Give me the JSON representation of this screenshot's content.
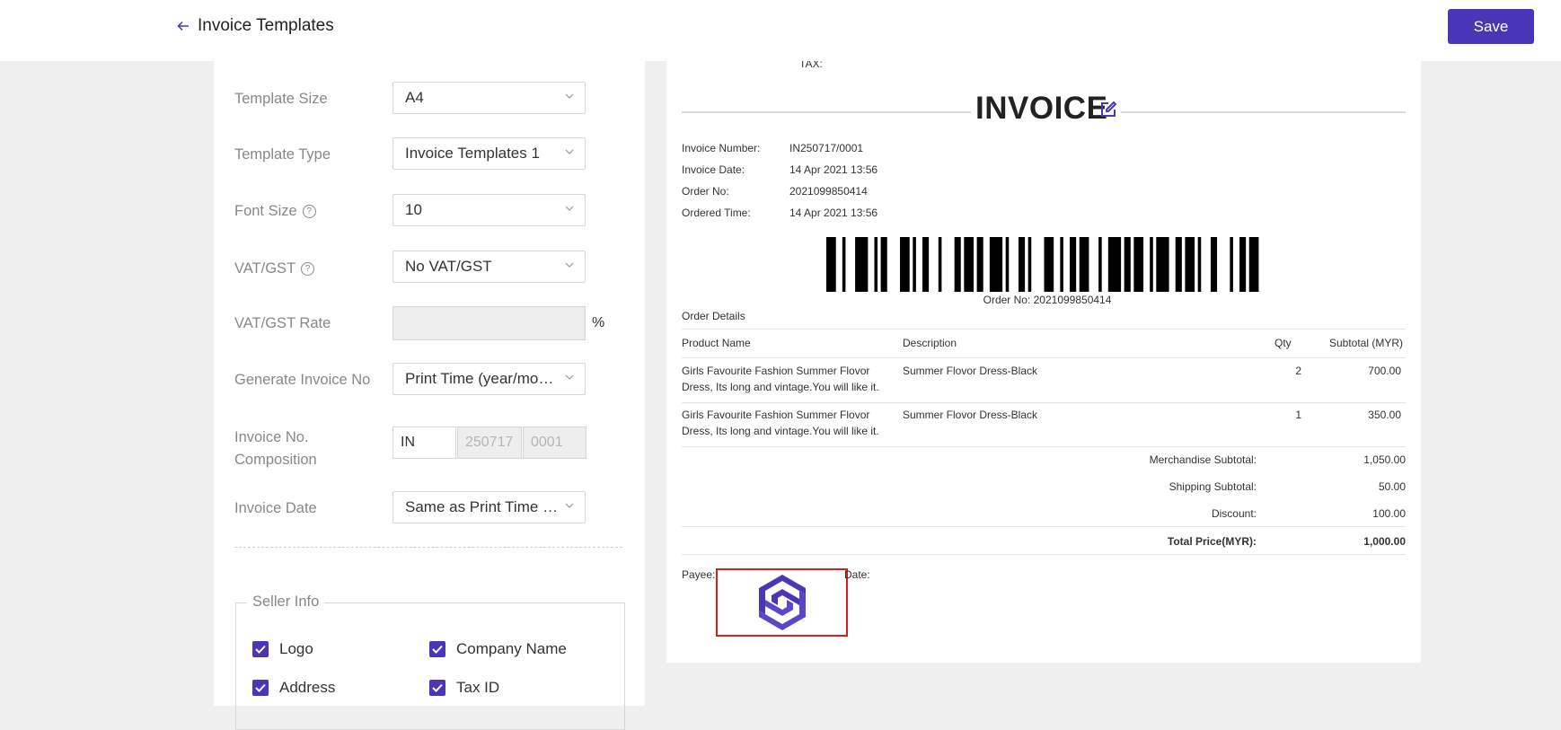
{
  "header": {
    "title": "Invoice Templates",
    "save_label": "Save"
  },
  "settings": {
    "template_size": {
      "label": "Template Size",
      "value": "A4"
    },
    "template_type": {
      "label": "Template Type",
      "value": "Invoice Templates 1"
    },
    "font_size": {
      "label": "Font Size",
      "value": "10"
    },
    "vat_gst": {
      "label": "VAT/GST",
      "value": "No VAT/GST"
    },
    "vat_gst_rate": {
      "label": "VAT/GST Rate",
      "value": "",
      "unit": "%"
    },
    "generate_invoice_no": {
      "label": "Generate Invoice No",
      "value": "Print Time (year/month/day)"
    },
    "invoice_no_composition": {
      "label_line1": "Invoice No.",
      "label_line2": "Composition",
      "prefix": "IN",
      "date_part": "250717",
      "serial_part": "0001"
    },
    "invoice_date": {
      "label": "Invoice Date",
      "value": "Same as Print Time / Order Time"
    }
  },
  "seller_info": {
    "legend": "Seller Info",
    "checkboxes": [
      {
        "label": "Logo",
        "checked": true
      },
      {
        "label": "Company Name",
        "checked": true
      },
      {
        "label": "Address",
        "checked": true
      },
      {
        "label": "Tax ID",
        "checked": true
      }
    ]
  },
  "invoice": {
    "cut_text": "TAX:",
    "title": "INVOICE",
    "meta": [
      {
        "key": "Invoice Number:",
        "value": "IN250717/0001"
      },
      {
        "key": "Invoice Date:",
        "value": "14 Apr 2021 13:56"
      },
      {
        "key": "Order No:",
        "value": "2021099850414"
      },
      {
        "key": "Ordered Time:",
        "value": "14 Apr 2021 13:56"
      }
    ],
    "barcode_text": "Order No: 2021099850414",
    "order_details_title": "Order Details",
    "columns": {
      "product": "Product Name",
      "description": "Description",
      "qty": "Qty",
      "subtotal": "Subtotal (MYR)"
    },
    "items": [
      {
        "product": "Girls Favourite Fashion Summer Flovor Dress, Its long and vintage.You will like it.",
        "description": "Summer Flovor Dress-Black",
        "qty": "2",
        "subtotal": "700.00"
      },
      {
        "product": "Girls Favourite Fashion Summer Flovor Dress, Its long and vintage.You will like it.",
        "description": "Summer Flovor Dress-Black",
        "qty": "1",
        "subtotal": "350.00"
      }
    ],
    "totals": [
      {
        "key": "Merchandise Subtotal:",
        "value": "1,050.00"
      },
      {
        "key": "Shipping Subtotal:",
        "value": "50.00"
      },
      {
        "key": "Discount:",
        "value": "100.00"
      }
    ],
    "grand_total": {
      "key": "Total Price(MYR):",
      "value": "1,000.00"
    },
    "payee_label": "Payee:",
    "date_label": "Date:"
  },
  "colors": {
    "accent": "#4a36b8",
    "highlight_border": "#d42020"
  }
}
